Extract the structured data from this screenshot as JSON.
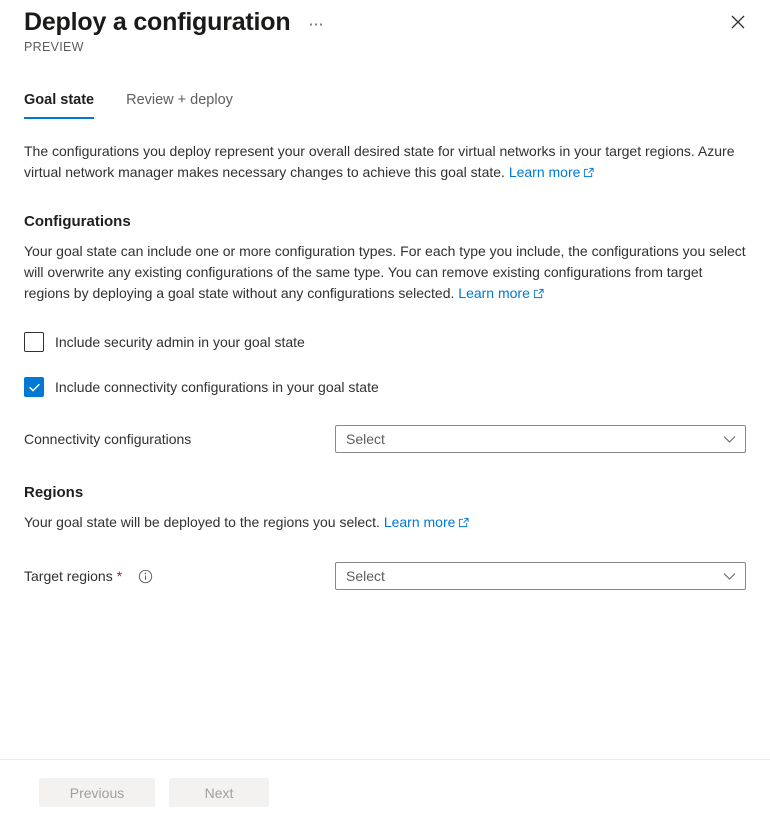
{
  "header": {
    "title": "Deploy a configuration",
    "preview_label": "PREVIEW",
    "more_icon": "ellipsis-icon",
    "close_icon": "close-icon"
  },
  "tabs": [
    {
      "label": "Goal state",
      "active": true
    },
    {
      "label": "Review + deploy",
      "active": false
    }
  ],
  "intro": {
    "text": "The configurations you deploy represent your overall desired state for virtual networks in your target regions. Azure virtual network manager makes necessary changes to achieve this goal state. ",
    "link_label": "Learn more"
  },
  "configurations": {
    "heading": "Configurations",
    "description": "Your goal state can include one or more configuration types. For each type you include, the configurations you select will overwrite any existing configurations of the same type. You can remove existing configurations from target regions by deploying a goal state without any configurations selected. ",
    "link_label": "Learn more",
    "checkboxes": [
      {
        "label": "Include security admin in your goal state",
        "checked": false
      },
      {
        "label": "Include connectivity configurations in your goal state",
        "checked": true
      }
    ],
    "field": {
      "label": "Connectivity configurations",
      "value": "Select",
      "chevron_icon": "chevron-down-icon"
    }
  },
  "regions": {
    "heading": "Regions",
    "description": "Your goal state will be deployed to the regions you select. ",
    "link_label": "Learn more",
    "field": {
      "label": "Target regions",
      "required_marker": "*",
      "info_icon": "info-icon",
      "value": "Select",
      "chevron_icon": "chevron-down-icon"
    }
  },
  "footer": {
    "previous_label": "Previous",
    "next_label": "Next"
  },
  "colors": {
    "accent": "#0078d4",
    "link": "#0078d4",
    "required": "#a4262c",
    "text": "#323130",
    "muted": "#605e5c"
  }
}
